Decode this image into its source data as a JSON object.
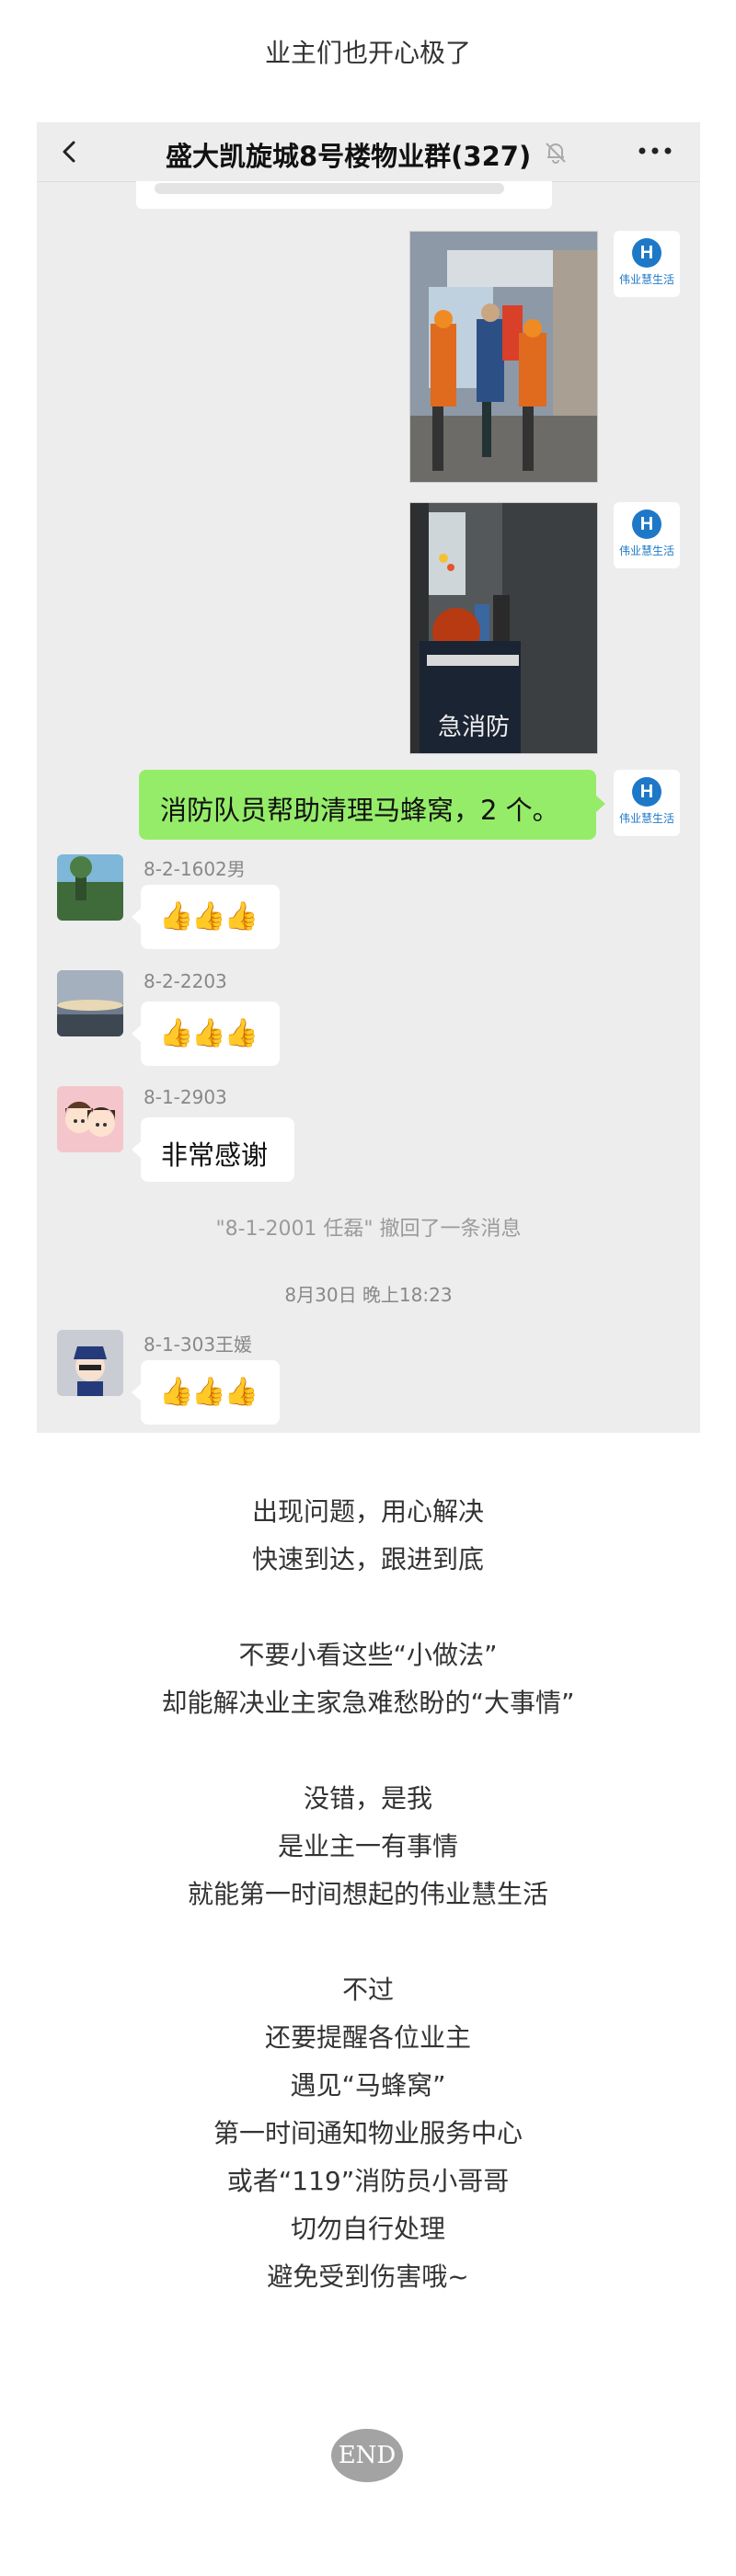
{
  "intro": "业主们也开心极了",
  "chat": {
    "group_title": "盛大凯旋城8号楼物业群(327)",
    "brand_avatar": {
      "icon": "H",
      "label": "伟业慧生活"
    },
    "green_message": "消防队员帮助清理马蜂窝，2 个。",
    "photo2_overlay": "急消防",
    "messages": [
      {
        "sender": "8-2-1602男",
        "content": "👍👍👍"
      },
      {
        "sender": "8-2-2203",
        "content": "👍👍👍"
      },
      {
        "sender": "8-1-2903",
        "content": "非常感谢"
      },
      {
        "sender": "8-1-303王媛",
        "content": "👍👍👍"
      }
    ],
    "system_message": "\"8-1-2001 任磊\" 撤回了一条消息",
    "timestamp": "8月30日 晚上18:23"
  },
  "article": {
    "lines": [
      "出现问题，用心解决",
      "快速到达，跟进到底",
      "不要小看这些“小做法”",
      "却能解决业主家急难愁盼的“大事情”",
      "没错，是我",
      "是业主一有事情",
      "就能第一时间想起的伟业慧生活",
      "不过",
      "还要提醒各位业主",
      "遇见“马蜂窝”",
      "第一时间通知物业服务中心",
      "或者“119”消防员小哥哥",
      "切勿自行处理",
      "避免受到伤害哦~"
    ]
  },
  "end_label": "END",
  "colors": {
    "green_bubble": "#95ec69",
    "chat_bg": "#ededed",
    "brand_blue": "#1e78c8"
  }
}
